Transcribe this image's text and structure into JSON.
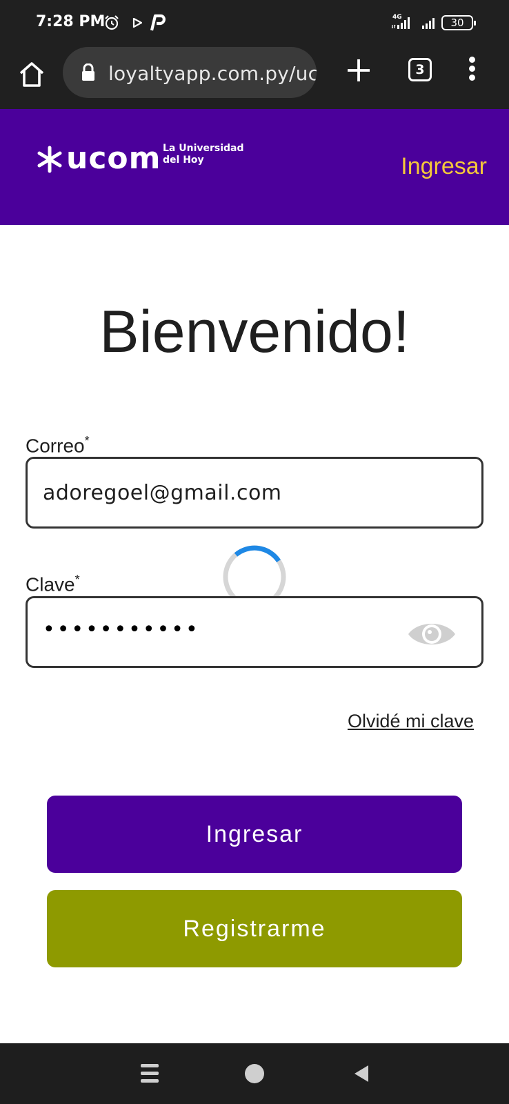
{
  "status_bar": {
    "time": "7:28 PM",
    "network": "4G",
    "battery": "30",
    "icons": [
      "alarm-icon",
      "play-icon",
      "p-app-icon",
      "signal-icon",
      "wifi-icon",
      "battery-icon"
    ]
  },
  "browser": {
    "url": "loyaltyapp.com.py/uc",
    "tab_count": "3",
    "icons": [
      "home-icon",
      "lock-icon",
      "plus-icon",
      "tabs-icon",
      "more-icon"
    ]
  },
  "header": {
    "logo_word": "ucom",
    "logo_tagline_1": "La Universidad",
    "logo_tagline_2": "del Hoy",
    "login_link": "Ingresar",
    "colors": {
      "background": "#4b009b",
      "link": "#f5c83a"
    }
  },
  "main": {
    "title": "Bienvenido!",
    "email_label": "Correo",
    "email_required": "*",
    "email_value": "adoregoel@gmail.com",
    "password_label": "Clave",
    "password_required": "*",
    "password_value": "•••••••••••",
    "forgot_link": "Olvidé mi clave",
    "login_button": "Ingresar",
    "register_button": "Registrarme",
    "colors": {
      "login_button": "#4b009b",
      "register_button": "#8e9a00",
      "spinner": "#1e88e5"
    }
  },
  "nav_bar": {
    "icons": [
      "recent-apps-icon",
      "home-circle-icon",
      "back-icon"
    ]
  }
}
